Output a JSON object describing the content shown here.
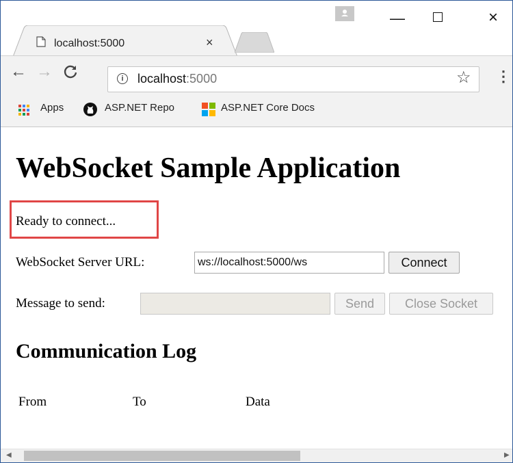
{
  "browser": {
    "tab_title": "localhost:5000",
    "tab_close": "×",
    "window_controls": {
      "minimize": "—",
      "close": "×"
    },
    "nav": {
      "back": "←",
      "forward": "→",
      "reload": "C"
    },
    "address": {
      "info": "i",
      "host": "localhost",
      "port": ":5000"
    },
    "star": "☆",
    "menu": "⋮",
    "bookmarks": [
      {
        "label": "Apps",
        "icon": "apps-grid-icon"
      },
      {
        "label": "ASP.NET Repo",
        "icon": "github-icon"
      },
      {
        "label": "ASP.NET Core Docs",
        "icon": "microsoft-icon"
      }
    ]
  },
  "page": {
    "heading": "WebSocket Sample Application",
    "status": "Ready to connect...",
    "url_label": "WebSocket Server URL:",
    "url_value": "ws://localhost:5000/ws",
    "connect_label": "Connect",
    "message_label": "Message to send:",
    "send_label": "Send",
    "close_socket_label": "Close Socket",
    "log_heading": "Communication Log",
    "log_columns": [
      "From",
      "To",
      "Data"
    ]
  },
  "colors": {
    "highlight": "#e04646",
    "chrome_bg": "#f2f2f2",
    "window_border": "#2b5797"
  }
}
